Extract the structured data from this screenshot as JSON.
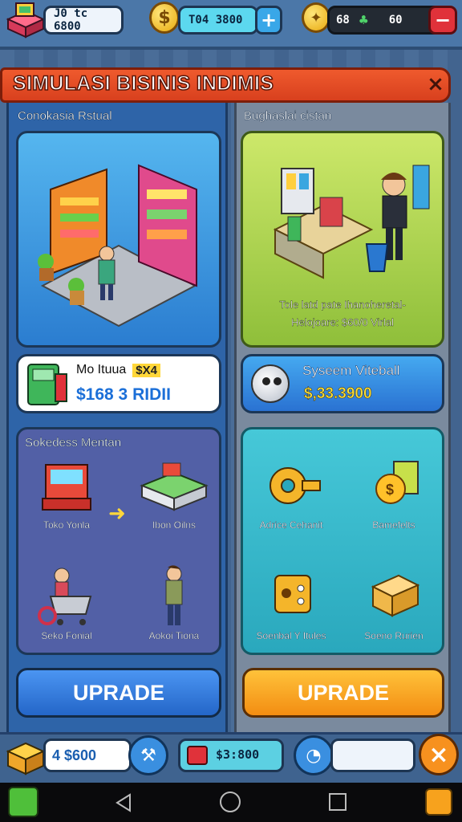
{
  "topbar": {
    "inventory_value": "J0 tc 6800",
    "money_value": "T04 3800",
    "money_add_label": "+",
    "gold_left": "68",
    "gold_right": "60",
    "exit_label": "−"
  },
  "panel": {
    "title": "SIMULASI BISINIS INDIMIS",
    "close_label": "×"
  },
  "left": {
    "section_title": "Conokasia Rstual",
    "stat_badge": "Mo Ituua",
    "stat_tag": "$X4",
    "stat_value": "$168 3 RIDII",
    "sub_title": "Sokedess Mentan",
    "items": [
      {
        "label": "Toko Yonla"
      },
      {
        "label": "Ibon Oilns"
      },
      {
        "label": "Seko Fonial"
      },
      {
        "label": "Aokoi Tiona"
      }
    ],
    "upgrade_label": "UPRADE"
  },
  "right": {
    "section_title": "Bughaslai cistan",
    "caption_line1": "Tole latd pate Ihanoheretal-",
    "caption_line2": "Helojoare: $60/0 Virlal",
    "system_title": "Syseem Viteball",
    "system_value": "$,33.3900",
    "items": [
      {
        "label": "Adrice Cehanit"
      },
      {
        "label": "Bamefelts"
      },
      {
        "label": "Soenbal Y Itules"
      },
      {
        "label": "Soeno Rurien"
      }
    ],
    "upgrade_label": "UPRADE"
  },
  "bottom": {
    "left_value": "4 $600",
    "mid_value": "$3:800",
    "close_label": "×"
  },
  "colors": {
    "accent_orange": "#f7a21d",
    "accent_blue": "#2f7fe0",
    "header_red": "#e34c24",
    "teal": "#2fb8c6"
  }
}
